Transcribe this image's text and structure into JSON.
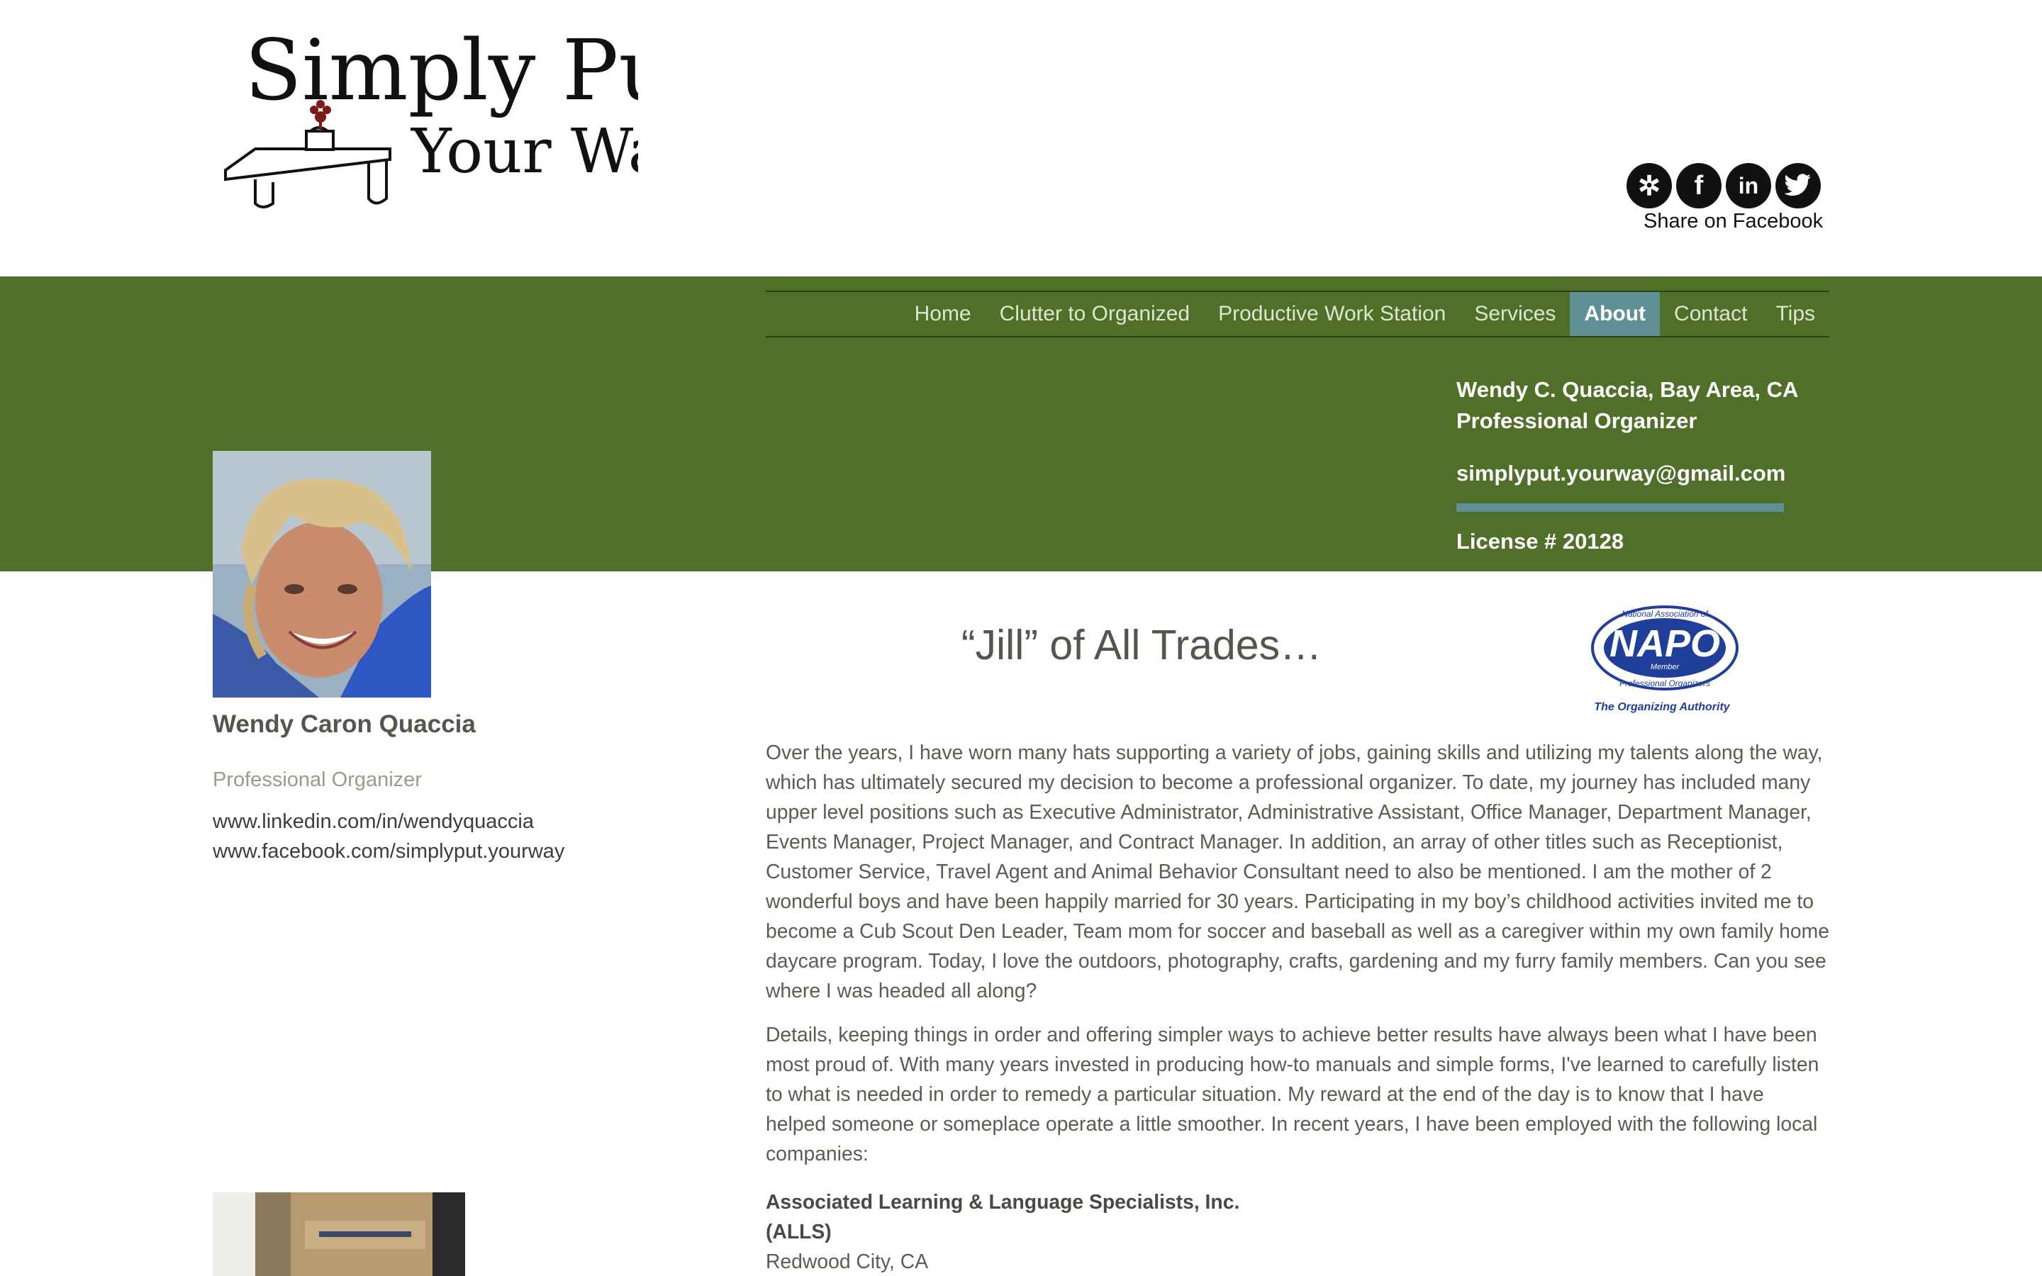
{
  "header": {
    "logo": {
      "line1": "Simply Put",
      "line2": "Your Way"
    },
    "social": {
      "icons": [
        "yelp-icon",
        "facebook-icon",
        "linkedin-icon",
        "twitter-icon"
      ],
      "share_label": "Share on Facebook"
    }
  },
  "nav": {
    "items": [
      {
        "label": "Home"
      },
      {
        "label": "Clutter to Organized"
      },
      {
        "label": "Productive Work Station"
      },
      {
        "label": "Services"
      },
      {
        "label": "About",
        "active": true
      },
      {
        "label": "Contact"
      },
      {
        "label": "Tips"
      }
    ]
  },
  "contact": {
    "name_line": "Wendy C. Quaccia, Bay Area, CA",
    "title": "Professional Organizer",
    "email": "simplyput.yourway@gmail.com",
    "license": "License # 20128"
  },
  "profile": {
    "name": "Wendy Caron Quaccia",
    "title": "Professional Organizer",
    "linkedin": "www.linkedin.com/in/wendyquaccia",
    "facebook": "www.facebook.com/simplyput.yourway"
  },
  "main": {
    "heading": "“Jill” of All Trades…",
    "napo_badge": {
      "top_text": "National Association of",
      "name": "NAPO",
      "member": "Member",
      "bottom_text": "Professional Organizers",
      "tagline": "The Organizing Authority"
    },
    "paragraph1": "Over the years, I have worn many hats supporting a variety of jobs, gaining skills and utilizing my talents along the way, which has ultimately secured my decision to become a professional organizer. To date, my journey has included many upper level positions such as Executive Administrator, Administrative Assistant, Office Manager, Department Manager, Events Manager, Project Manager, and Contract Manager. In addition, an array of other titles such as Receptionist, Customer Service, Travel Agent and Animal Behavior Consultant need to also be mentioned. I am the mother of 2 wonderful boys and have been happily married for 30 years. Participating in my boy’s childhood activities invited me to become a Cub Scout Den Leader, Team mom for soccer and baseball as well as a caregiver within my own family home daycare program. Today, I love the outdoors, photography, crafts, gardening and my furry family members. Can you see where I was headed all along?",
    "paragraph2": "Details, keeping things in order and offering simpler ways to achieve better results have always been what I have been most proud of. With many years invested in producing how-to manuals and simple forms, I've learned to carefully listen to what is needed in order to remedy a particular situation. My reward at the end of the day is to know that I have helped someone or someplace operate a little smoother. In recent years, I have been employed with the following local companies:",
    "company": {
      "name": "Associated Learning & Language Specialists, Inc.",
      "abbr": "(ALLS)",
      "location": "Redwood City, CA"
    }
  },
  "colors": {
    "band_green": "#506f28",
    "accent_teal": "#5e9096",
    "nav_text": "#dfe5cf",
    "body_text": "#5b5b52"
  }
}
